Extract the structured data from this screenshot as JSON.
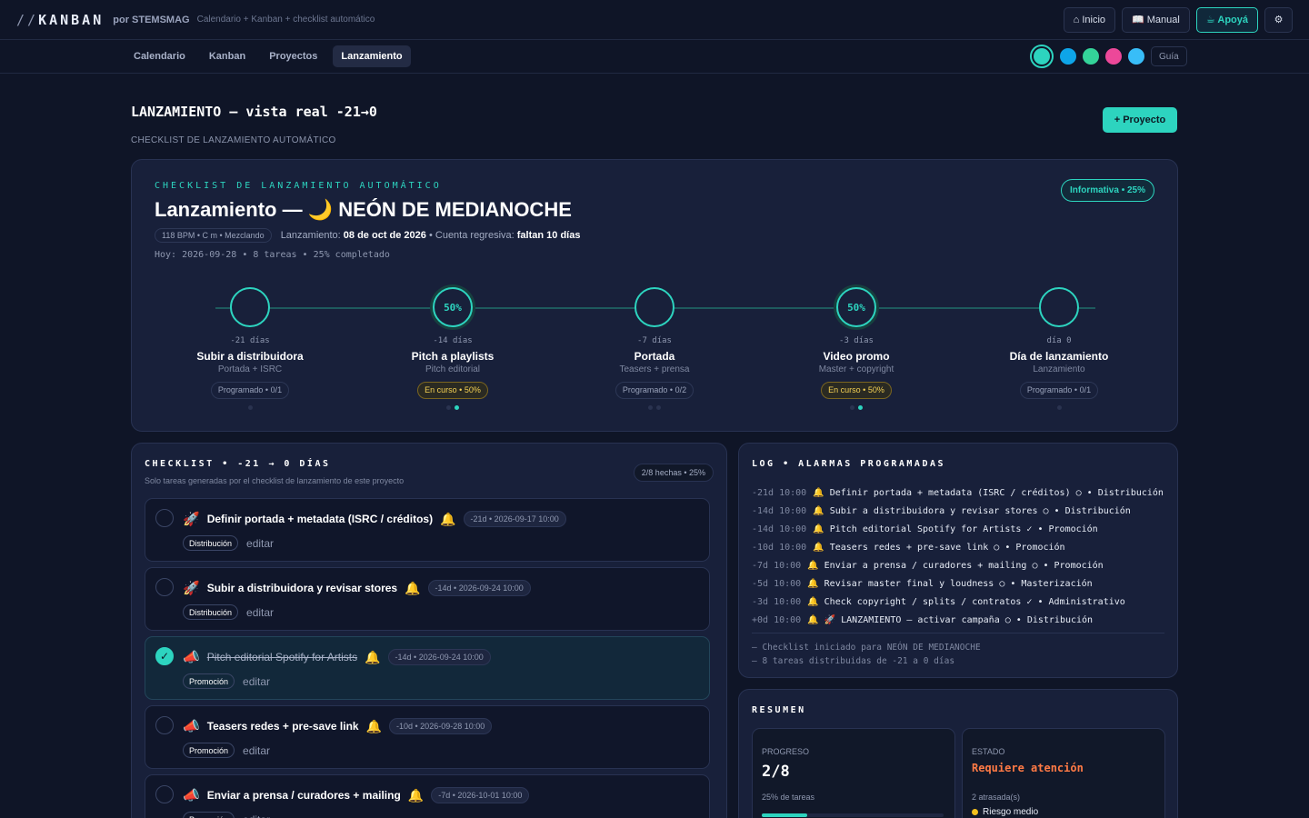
{
  "topbar": {
    "logo_prefix": "//",
    "logo_text": "KANBAN",
    "by": "por STEMSMAG",
    "tagline": "Calendario + Kanban + checklist automático",
    "buttons": {
      "inicio": "⌂ Inicio",
      "manual": "📖 Manual",
      "apoya": "☕ Apoyá",
      "settings_icon": "⚙"
    }
  },
  "nav": {
    "tabs": [
      "Calendario",
      "Kanban",
      "Proyectos",
      "Lanzamiento"
    ],
    "active_tab": "Lanzamiento",
    "theme_swatches": [
      "#2dd4bf",
      "#0ea5e9",
      "#34d399",
      "#ec4899",
      "#38bdf8"
    ],
    "guide": "Guía"
  },
  "page": {
    "title": "LANZAMIENTO — vista real -21→0",
    "subtitle": "CHECKLIST DE LANZAMIENTO AUTOMÁTICO",
    "new_project": "+ Proyecto"
  },
  "hero": {
    "eyebrow": "CHECKLIST DE LANZAMIENTO AUTOMÁTICO",
    "title": "Lanzamiento — 🌙 NEÓN DE MEDIANOCHE",
    "project_meta": "118 BPM • C m • Mezclando",
    "launch_label": "Lanzamiento:",
    "launch_date": "08 de oct de 2026",
    "countdown_label": "• Cuenta regresiva:",
    "countdown": "faltan 10 días",
    "today": "Hoy: 2026-09-28 • 8 tareas • 25% completado",
    "badge": "Informativa • 25%",
    "steps": [
      {
        "ring": "",
        "when": "-21 días",
        "name": "Subir a distribuidora",
        "desc": "Portada + ISRC",
        "status": "Programado • 0/1",
        "warn": false,
        "dots": [
          false
        ]
      },
      {
        "ring": "50%",
        "when": "-14 días",
        "name": "Pitch a playlists",
        "desc": "Pitch editorial",
        "status": "En curso • 50%",
        "warn": true,
        "dots": [
          false,
          true
        ]
      },
      {
        "ring": "",
        "when": "-7 días",
        "name": "Portada",
        "desc": "Teasers + prensa",
        "status": "Programado • 0/2",
        "warn": false,
        "dots": [
          false,
          false
        ]
      },
      {
        "ring": "50%",
        "when": "-3 días",
        "name": "Video promo",
        "desc": "Master + copyright",
        "status": "En curso • 50%",
        "warn": true,
        "dots": [
          false,
          true
        ]
      },
      {
        "ring": "",
        "when": "día 0",
        "name": "Día de lanzamiento",
        "desc": "Lanzamiento",
        "status": "Programado • 0/1",
        "warn": false,
        "dots": [
          false
        ]
      }
    ]
  },
  "checklist": {
    "title": "CHECKLIST • -21 → 0 DÍAS",
    "subtitle": "Solo tareas generadas por el checklist de lanzamiento de este proyecto",
    "badge": "2/8 hechas • 25%",
    "edit_label": "editar",
    "tasks": [
      {
        "icon": "🚀",
        "title": "Definir portada + metadata (ISRC / créditos)",
        "date": "-21d • 2026-09-17 10:00",
        "category": "Distribución",
        "done": false
      },
      {
        "icon": "🚀",
        "title": "Subir a distribuidora y revisar stores",
        "date": "-14d • 2026-09-24 10:00",
        "category": "Distribución",
        "done": false
      },
      {
        "icon": "📣",
        "title": "Pitch editorial Spotify for Artists",
        "date": "-14d • 2026-09-24 10:00",
        "category": "Promoción",
        "done": true
      },
      {
        "icon": "📣",
        "title": "Teasers redes + pre-save link",
        "date": "-10d • 2026-09-28 10:00",
        "category": "Promoción",
        "done": false
      },
      {
        "icon": "📣",
        "title": "Enviar a prensa / curadores + mailing",
        "date": "-7d • 2026-10-01 10:00",
        "category": "Promoción",
        "done": false
      }
    ]
  },
  "log": {
    "title": "LOG • ALARMAS PROGRAMADAS",
    "entries": [
      {
        "when": "-21d 10:00",
        "text": "🔔 Definir portada + metadata (ISRC / créditos) ○ • Distribución"
      },
      {
        "when": "-14d 10:00",
        "text": "🔔 Subir a distribuidora y revisar stores ○ • Distribución"
      },
      {
        "when": "-14d 10:00",
        "text": "🔔 Pitch editorial Spotify for Artists ✓ • Promoción"
      },
      {
        "when": "-10d 10:00",
        "text": "🔔 Teasers redes + pre-save link ○ • Promoción"
      },
      {
        "when": "-7d 10:00",
        "text": "🔔 Enviar a prensa / curadores + mailing ○ • Promoción"
      },
      {
        "when": "-5d 10:00",
        "text": "🔔 Revisar master final y loudness ○ • Masterización"
      },
      {
        "when": "-3d 10:00",
        "text": "🔔 Check copyright / splits / contratos ✓ • Administrativo"
      },
      {
        "when": "+0d 10:00",
        "text": "🔔 🚀 LANZAMIENTO — activar campaña ○ • Distribución"
      }
    ],
    "notes": [
      "— Checklist iniciado para NEÓN DE MEDIANOCHE",
      "— 8 tareas distribuidas de -21 a 0 días"
    ]
  },
  "summary": {
    "title": "RESUMEN",
    "progress_label": "PROGRESO",
    "progress_value": "2/8",
    "progress_note": "25% de tareas",
    "progress_fraction": 0.25,
    "status_label": "ESTADO",
    "status_value": "Requiere atención",
    "status_note": "2 atrasada(s)",
    "risk": "Riesgo medio"
  }
}
